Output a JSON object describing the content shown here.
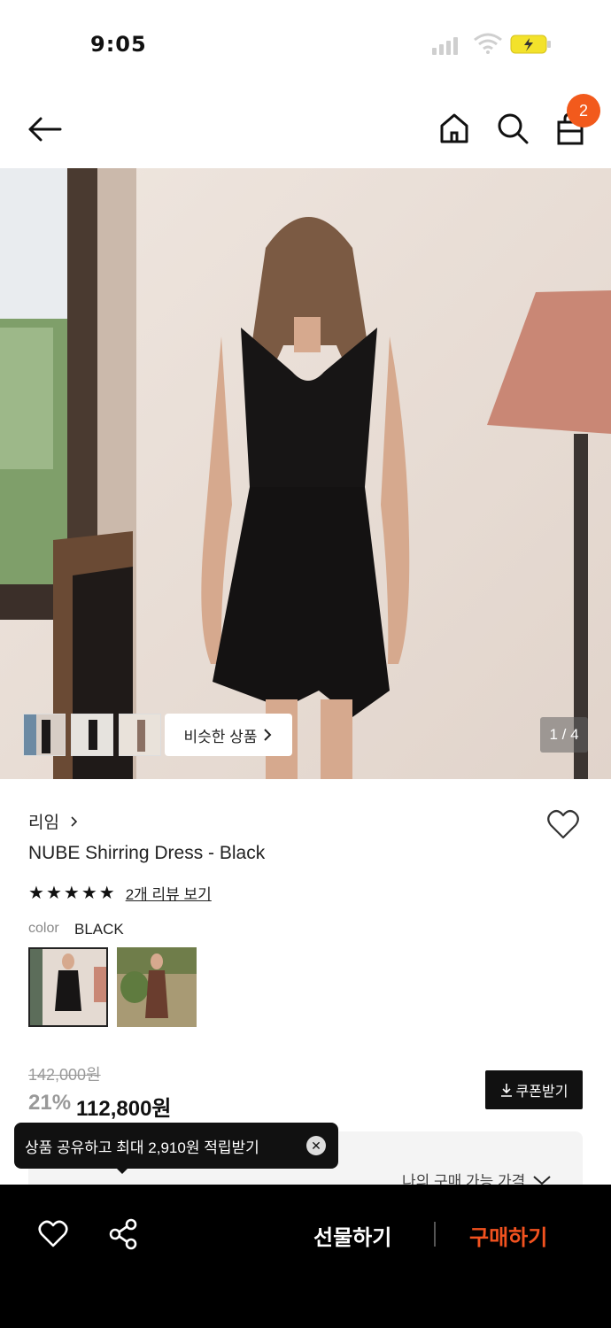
{
  "status_bar": {
    "time": "9:05"
  },
  "header": {
    "cart_count": "2"
  },
  "gallery": {
    "similar_label": "비슷한 상품",
    "page_indicator": "1 / 4"
  },
  "product": {
    "brand": "리임",
    "name": "NUBE Shirring Dress - Black",
    "rating": 5,
    "review_link": "2개 리뷰 보기",
    "color_label": "color",
    "color_value": "BLACK",
    "original_price": "142,000원",
    "discount": "21%",
    "price": "112,800원",
    "coupon_label": "쿠폰받기",
    "my_price_label": "나의 구매 가능 가격"
  },
  "toast": {
    "message": "상품 공유하고 최대 2,910원 적립받기"
  },
  "bottom_bar": {
    "gift_label": "선물하기",
    "buy_label": "구매하기"
  },
  "colors": {
    "accent": "#f25a1c",
    "buy": "#f2521f"
  }
}
